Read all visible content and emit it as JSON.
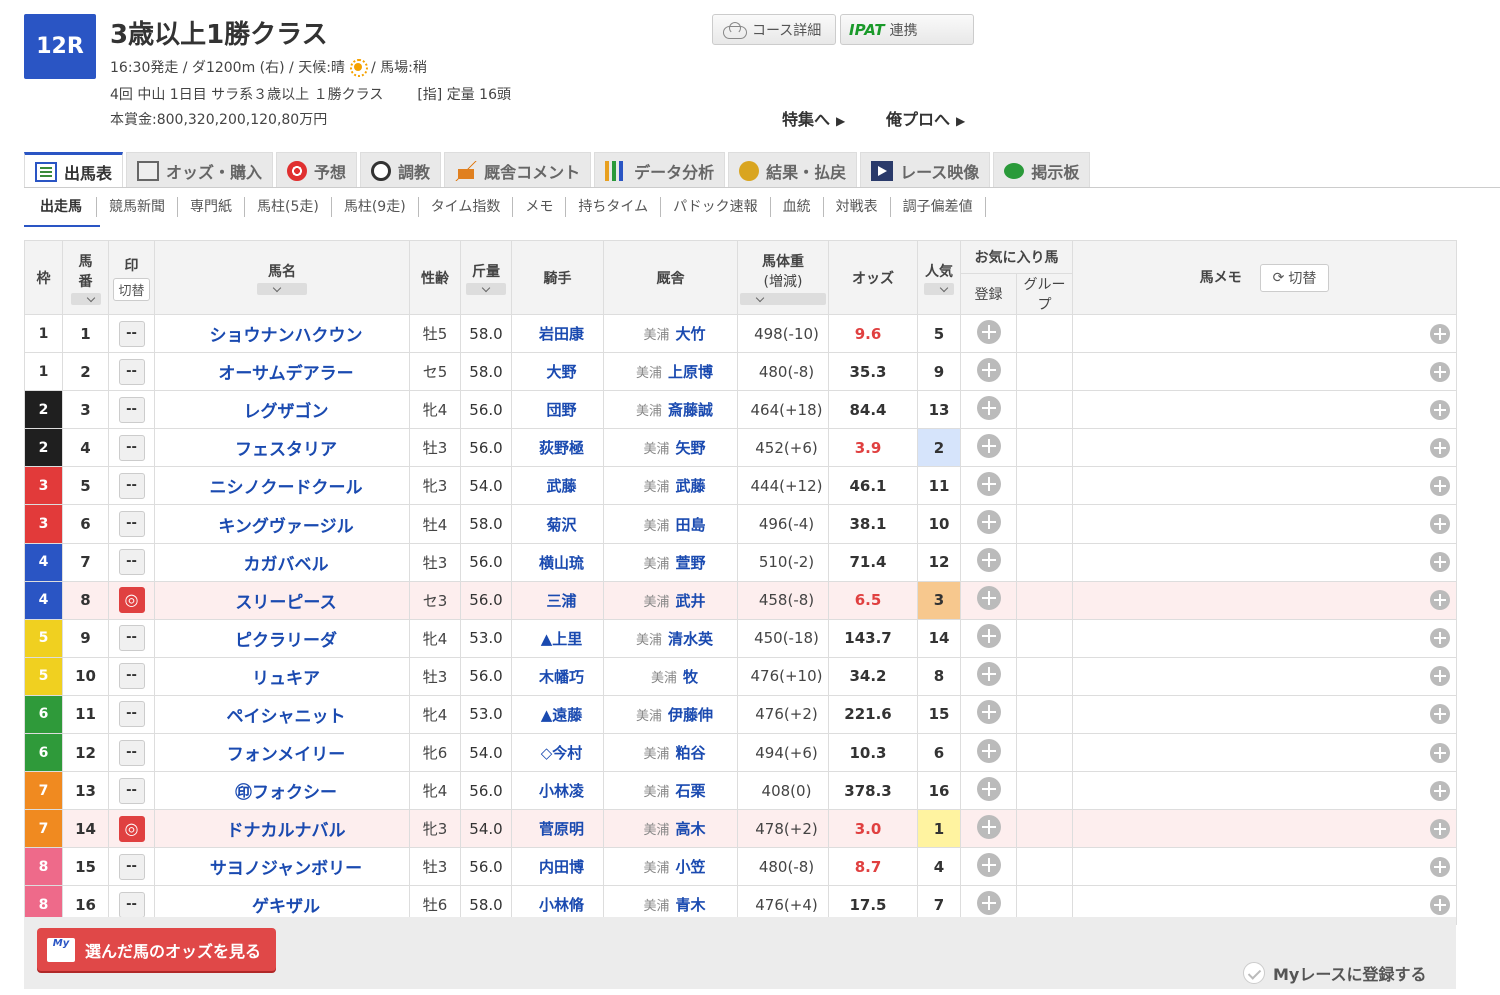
{
  "race": {
    "number": "12R",
    "title": "3歳以上1勝クラス",
    "info_line1_a": "16:30発走 / ダ1200m (右) / 天候:晴",
    "info_line1_b": "/ 馬場:稍",
    "info_line2": "4回 中山 1日目 サラ系３歳以上 １勝クラス",
    "info_line2_cond": "[指] 定量 16頭",
    "prize": "本賞金:800,320,200,120,80万円"
  },
  "top_buttons": {
    "course": "コース詳細",
    "ipat_logo": "IPAT",
    "ipat_text": "連携"
  },
  "feature_links": [
    "特集へ",
    "俺プロへ"
  ],
  "tabs": [
    "出馬表",
    "オッズ・購入",
    "予想",
    "調教",
    "厩舎コメント",
    "データ分析",
    "結果・払戻",
    "レース映像",
    "掲示板"
  ],
  "subtabs": [
    "出走馬",
    "競馬新聞",
    "専門紙",
    "馬柱(5走)",
    "馬柱(9走)",
    "タイム指数",
    "メモ",
    "持ちタイム",
    "パドック速報",
    "血統",
    "対戦表",
    "調子偏差値"
  ],
  "table_header": {
    "waku": "枠",
    "umaban_1": "馬",
    "umaban_2": "番",
    "mark": "印",
    "swap": "切替",
    "horse": "馬名",
    "sexage": "性齢",
    "kinryo": "斤量",
    "jockey": "騎手",
    "stable": "厩舎",
    "weight_1": "馬体重",
    "weight_2": "(増減)",
    "odds": "オッズ",
    "ninki": "人気",
    "fav": "お気に入り馬",
    "fav_reg": "登録",
    "fav_group": "グループ",
    "memo": "馬メモ",
    "memo_swap": "切替"
  },
  "waku_colors": {
    "1": "#ffffff",
    "2": "#1f1f1f",
    "3": "#e23a3a",
    "4": "#2a55c4",
    "5": "#f0d020",
    "6": "#2f9a3a",
    "7": "#f08a20",
    "8": "#ee6a8a"
  },
  "rows": [
    {
      "waku": "1",
      "umaban": "1",
      "mark": "--",
      "horse": "ショウナンハクウン",
      "sexage": "牡5",
      "kinryo": "58.0",
      "jockey": "岩田康",
      "stable_loc": "美浦",
      "stable": "大竹",
      "weight": "498(-10)",
      "odds": "9.6",
      "ninki": "5"
    },
    {
      "waku": "1",
      "umaban": "2",
      "mark": "--",
      "horse": "オーサムデアラー",
      "sexage": "セ5",
      "kinryo": "58.0",
      "jockey": "大野",
      "stable_loc": "美浦",
      "stable": "上原博",
      "weight": "480(-8)",
      "odds": "35.3",
      "ninki": "9"
    },
    {
      "waku": "2",
      "umaban": "3",
      "mark": "--",
      "horse": "レグザゴン",
      "sexage": "牝4",
      "kinryo": "56.0",
      "jockey": "団野",
      "stable_loc": "美浦",
      "stable": "斎藤誠",
      "weight": "464(+18)",
      "odds": "84.4",
      "ninki": "13"
    },
    {
      "waku": "2",
      "umaban": "4",
      "mark": "--",
      "horse": "フェスタリア",
      "sexage": "牡3",
      "kinryo": "56.0",
      "jockey": "荻野極",
      "stable_loc": "美浦",
      "stable": "矢野",
      "weight": "452(+6)",
      "odds": "3.9",
      "ninki": "2"
    },
    {
      "waku": "3",
      "umaban": "5",
      "mark": "--",
      "horse": "ニシノクードクール",
      "sexage": "牝3",
      "kinryo": "54.0",
      "jockey": "武藤",
      "stable_loc": "美浦",
      "stable": "武藤",
      "weight": "444(+12)",
      "odds": "46.1",
      "ninki": "11"
    },
    {
      "waku": "3",
      "umaban": "6",
      "mark": "--",
      "horse": "キングヴァージル",
      "sexage": "牡4",
      "kinryo": "58.0",
      "jockey": "菊沢",
      "stable_loc": "美浦",
      "stable": "田島",
      "weight": "496(-4)",
      "odds": "38.1",
      "ninki": "10"
    },
    {
      "waku": "4",
      "umaban": "7",
      "mark": "--",
      "horse": "カガバベル",
      "sexage": "牡3",
      "kinryo": "56.0",
      "jockey": "横山琉",
      "stable_loc": "美浦",
      "stable": "萱野",
      "weight": "510(-2)",
      "odds": "71.4",
      "ninki": "12"
    },
    {
      "waku": "4",
      "umaban": "8",
      "mark": "◎",
      "horse": "スリーピース",
      "sexage": "セ3",
      "kinryo": "56.0",
      "jockey": "三浦",
      "stable_loc": "美浦",
      "stable": "武井",
      "weight": "458(-8)",
      "odds": "6.5",
      "ninki": "3"
    },
    {
      "waku": "5",
      "umaban": "9",
      "mark": "--",
      "horse": "ピクラリーダ",
      "sexage": "牝4",
      "kinryo": "53.0",
      "jockey": "▲上里",
      "stable_loc": "美浦",
      "stable": "清水英",
      "weight": "450(-18)",
      "odds": "143.7",
      "ninki": "14"
    },
    {
      "waku": "5",
      "umaban": "10",
      "mark": "--",
      "horse": "リュキア",
      "sexage": "牡3",
      "kinryo": "56.0",
      "jockey": "木幡巧",
      "stable_loc": "美浦",
      "stable": "牧",
      "weight": "476(+10)",
      "odds": "34.2",
      "ninki": "8"
    },
    {
      "waku": "6",
      "umaban": "11",
      "mark": "--",
      "horse": "ペイシャニット",
      "sexage": "牝4",
      "kinryo": "53.0",
      "jockey": "▲遠藤",
      "stable_loc": "美浦",
      "stable": "伊藤伸",
      "weight": "476(+2)",
      "odds": "221.6",
      "ninki": "15"
    },
    {
      "waku": "6",
      "umaban": "12",
      "mark": "--",
      "horse": "フォンメイリー",
      "sexage": "牝6",
      "kinryo": "54.0",
      "jockey": "◇今村",
      "stable_loc": "美浦",
      "stable": "粕谷",
      "weight": "494(+6)",
      "odds": "10.3",
      "ninki": "6"
    },
    {
      "waku": "7",
      "umaban": "13",
      "mark": "--",
      "horse": "㊞フォクシー",
      "sexage": "牝4",
      "kinryo": "56.0",
      "jockey": "小林凌",
      "stable_loc": "美浦",
      "stable": "石栗",
      "weight": "408(0)",
      "odds": "378.3",
      "ninki": "16"
    },
    {
      "waku": "7",
      "umaban": "14",
      "mark": "◎",
      "horse": "ドナカルナバル",
      "sexage": "牝3",
      "kinryo": "54.0",
      "jockey": "菅原明",
      "stable_loc": "美浦",
      "stable": "高木",
      "weight": "478(+2)",
      "odds": "3.0",
      "ninki": "1"
    },
    {
      "waku": "8",
      "umaban": "15",
      "mark": "--",
      "horse": "サヨノジャンボリー",
      "sexage": "牡3",
      "kinryo": "56.0",
      "jockey": "内田博",
      "stable_loc": "美浦",
      "stable": "小笠",
      "weight": "480(-8)",
      "odds": "8.7",
      "ninki": "4"
    },
    {
      "waku": "8",
      "umaban": "16",
      "mark": "--",
      "horse": "ゲキザル",
      "sexage": "牡6",
      "kinryo": "58.0",
      "jockey": "小林脩",
      "stable_loc": "美浦",
      "stable": "青木",
      "weight": "476(+4)",
      "odds": "17.5",
      "ninki": "7"
    }
  ],
  "footer": {
    "odds_button": "選んだ馬のオッズを見る",
    "my_icon": "My",
    "myrace": "Myレースに登録する"
  }
}
